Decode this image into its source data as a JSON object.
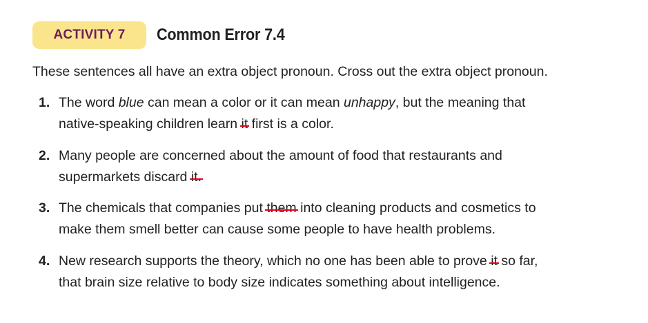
{
  "header": {
    "badge": "ACTIVITY 7",
    "title": "Common Error 7.4"
  },
  "instructions": "These sentences all have an extra object pronoun. Cross out the extra object pronoun.",
  "items": [
    {
      "number": "1.",
      "parts": {
        "a": "The word ",
        "b": "blue",
        "c": " can mean a color or it can mean ",
        "d": "unhappy",
        "e": ", but the meaning that",
        "f": "native-speaking children learn ",
        "g": "it",
        "h": " first is a color."
      }
    },
    {
      "number": "2.",
      "parts": {
        "a": "Many people are concerned about the amount of food that restaurants and",
        "b": "supermarkets discard ",
        "c": "it."
      }
    },
    {
      "number": "3.",
      "parts": {
        "a": "The chemicals that companies put ",
        "b": "them",
        "c": " into cleaning products and cosmetics to",
        "d": "make them smell better can cause some people to have health problems."
      }
    },
    {
      "number": "4.",
      "parts": {
        "a": "New research supports the theory, which no one has been able to prove ",
        "b": "it",
        "c": " so far,",
        "d": "that brain size relative to body size indicates something about intelligence."
      }
    }
  ],
  "colors": {
    "badge_bg": "#fbe58c",
    "badge_text": "#6b1d5c",
    "strike": "#e3001b"
  }
}
